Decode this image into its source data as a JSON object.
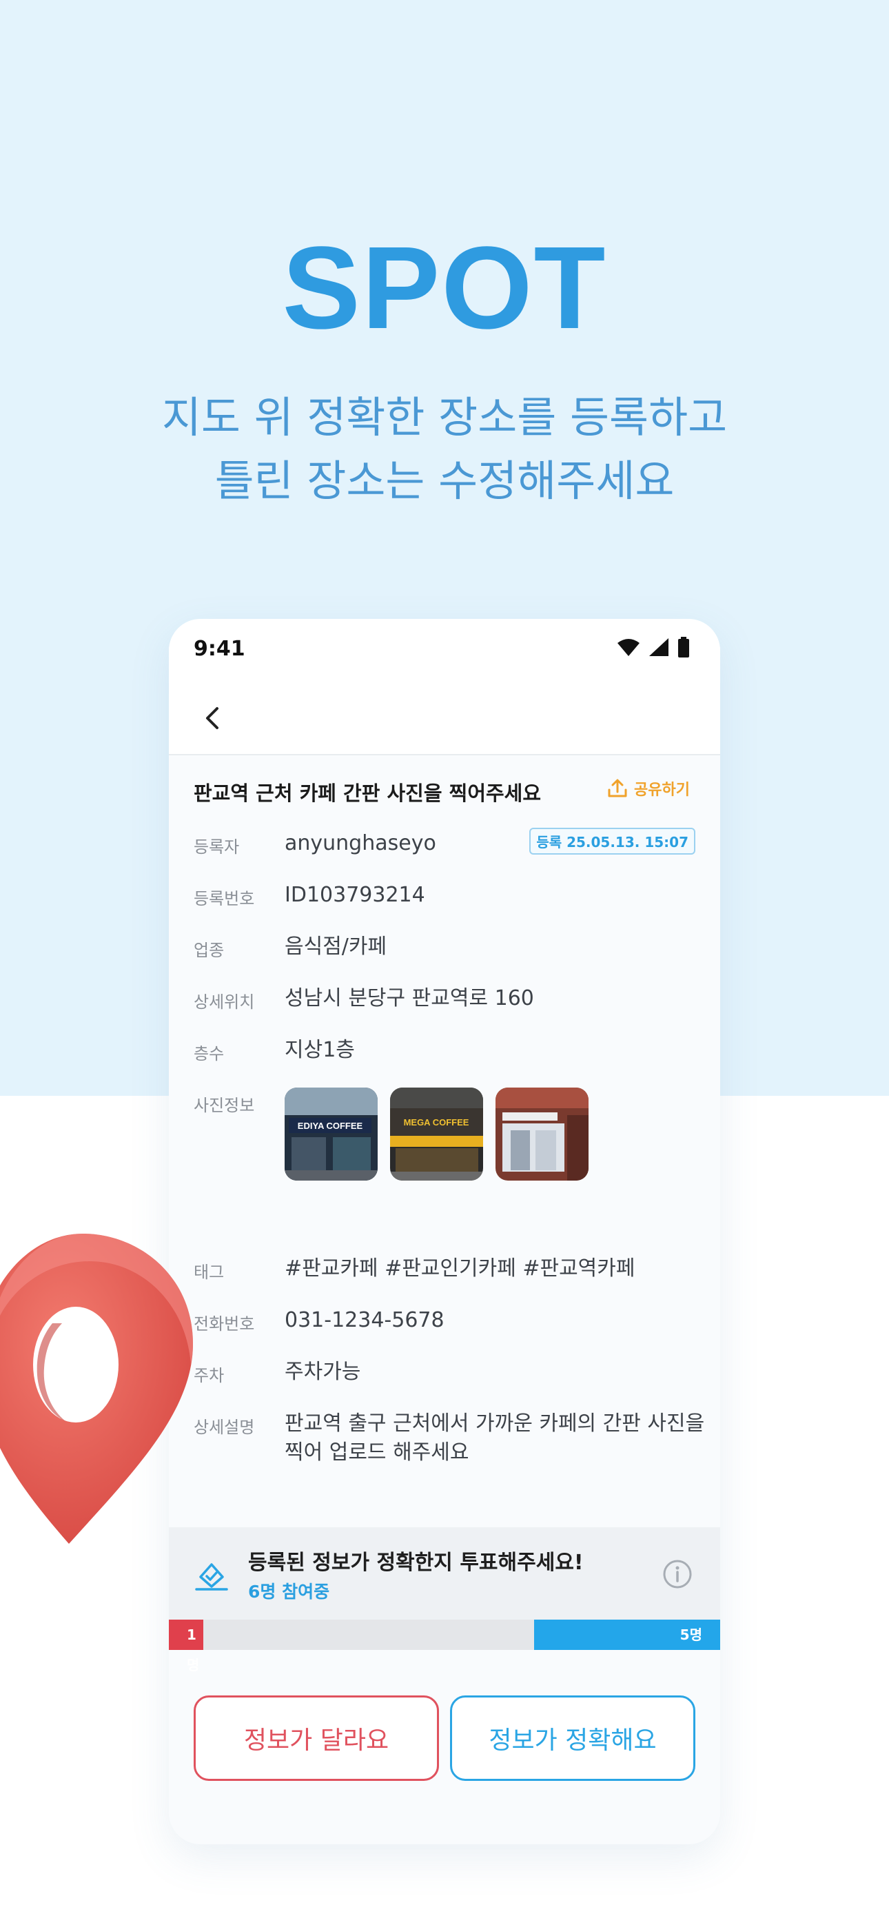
{
  "hero": {
    "title": "SPOT",
    "subtitle_line1": "지도 위 정확한 장소를 등록하고",
    "subtitle_line2": "틀린 장소는 수정해주세요"
  },
  "status_bar": {
    "time": "9:41",
    "icons": [
      "wifi-icon",
      "signal-icon",
      "battery-icon"
    ]
  },
  "nav": {
    "back_icon": "chevron-left-icon"
  },
  "post": {
    "title": "판교역 근처 카페 간판 사진을 찍어주세요",
    "share_label": "공유하기",
    "registered_badge": "등록 25.05.13. 15:07",
    "fields": {
      "registrant": {
        "label": "등록자",
        "value": "anyunghaseyo"
      },
      "reg_number": {
        "label": "등록번호",
        "value": "ID103793214"
      },
      "category": {
        "label": "업종",
        "value": "음식점/카페"
      },
      "location": {
        "label": "상세위치",
        "value": "성남시 분당구 판교역로 160"
      },
      "floor": {
        "label": "층수",
        "value": "지상1층"
      },
      "photos": {
        "label": "사진정보"
      },
      "tags": {
        "label": "태그",
        "value": "#판교카페 #판교인기카페 #판교역카페"
      },
      "phone": {
        "label": "전화번호",
        "value": "031-1234-5678"
      },
      "parking": {
        "label": "주차",
        "value": "주차가능"
      },
      "description": {
        "label": "상세설명",
        "value_line1": "판교역 출구 근처에서 가까운 카페의 간판 사진을",
        "value_line2": "찍어 업로드 해주세요"
      }
    },
    "photo_signs": [
      "EDIYA COFFEE",
      "MEGA COFFEE",
      ""
    ]
  },
  "vote": {
    "title": "등록된 정보가 정확한지 투표해주세요!",
    "participants": "6명 참여중",
    "no_count_label": "1명",
    "yes_count_label": "5명",
    "no_fraction": 0.0625,
    "yes_fraction": 0.3375,
    "no_button": "정보가 달라요",
    "yes_button": "정보가 정확해요"
  },
  "colors": {
    "brand_blue": "#2f9be0",
    "hero_bg": "#e3f3fc",
    "no_red": "#e0404c",
    "yes_blue": "#23a6ea",
    "share_orange": "#f0a22b",
    "pin_red": "#e85a52"
  }
}
